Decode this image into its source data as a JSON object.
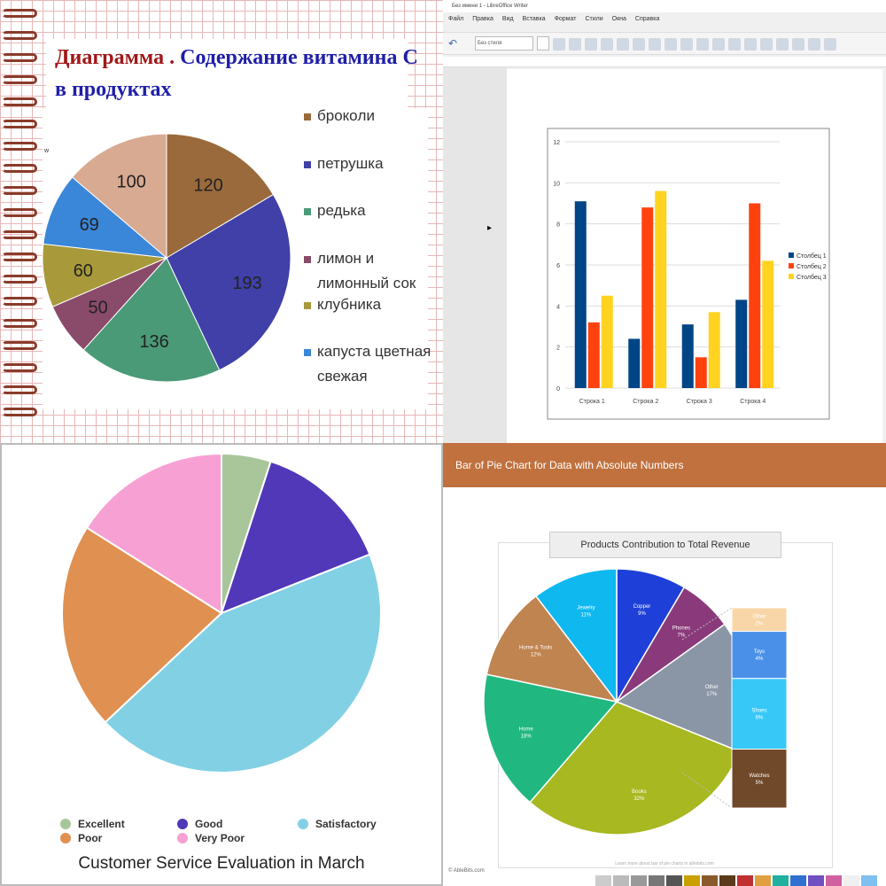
{
  "panel1": {
    "title_part1": "Диаграмма . ",
    "title_part2": "Содержание витамина С",
    "title_line2": "в продуктах",
    "chart_data": {
      "type": "pie",
      "title": "Диаграмма . Содержание витамина С в продуктах",
      "categories": [
        "брокoли",
        "петрушка",
        "редька",
        "лимон и лимонный сок",
        "клубника",
        "капуста цветная свежая",
        ""
      ],
      "values": [
        120,
        193,
        136,
        50,
        60,
        69,
        100
      ],
      "labels": [
        "120",
        "193",
        "136",
        "50",
        "60",
        "69",
        "100"
      ],
      "colors": [
        "#9a6a3c",
        "#4040a8",
        "#4a9a78",
        "#8a4a6a",
        "#a89a3a",
        "#3a86d8",
        "#d8aa92"
      ]
    },
    "legend": [
      "брокoли",
      "петрушка",
      "редька",
      "лимон и",
      "лимонный сок",
      "клубника",
      "капуста цветная",
      "свежая"
    ],
    "legend_colors": [
      "#9a6a3c",
      "#4040a8",
      "#4a9a78",
      "#8a4a6a",
      "#a89a3a",
      "#3a86d8"
    ]
  },
  "panel2": {
    "window_title": "Без имени 1 - LibreOffice Writer",
    "menu": [
      "Файл",
      "Правка",
      "Вид",
      "Вставка",
      "Формат",
      "Стили",
      "Окна",
      "Справка"
    ],
    "font_box": "Без стиля",
    "chart_data": {
      "type": "bar",
      "categories": [
        "Строка 1",
        "Строка 2",
        "Строка 3",
        "Строка 4"
      ],
      "series": [
        {
          "name": "Столбец 1",
          "values": [
            9.1,
            2.4,
            3.1,
            4.3
          ],
          "color": "#004586"
        },
        {
          "name": "Столбец 2",
          "values": [
            3.2,
            8.8,
            1.5,
            9.0
          ],
          "color": "#ff420e"
        },
        {
          "name": "Столбец 3",
          "values": [
            4.5,
            9.6,
            3.7,
            6.2
          ],
          "color": "#ffd320"
        }
      ],
      "ylim": [
        0,
        12
      ],
      "yticks": [
        "0",
        "2",
        "4",
        "6",
        "8",
        "10",
        "12"
      ],
      "grid": true,
      "legend": "right"
    }
  },
  "panel3": {
    "chart_data": {
      "type": "pie",
      "title": "Customer Service Evaluation in March",
      "categories": [
        "Excellent",
        "Good",
        "Satisfactory",
        "Poor",
        "Very Poor"
      ],
      "values": [
        5,
        14,
        44,
        21,
        16
      ],
      "colors": [
        "#a9c69a",
        "#5038b8",
        "#82d0e4",
        "#e09050",
        "#f7a0d4"
      ]
    },
    "legend": [
      "Excellent",
      "Good",
      "Satisfactory",
      "Poor",
      "Very Poor"
    ],
    "title": "Customer Service Evaluation in March"
  },
  "panel4": {
    "banner": "Bar of Pie Chart for Data with Absolute Numbers",
    "chart_data": {
      "type": "pie",
      "title": "Products Contribution to Total Revenue",
      "categories": [
        "Copper",
        "Phones",
        "Other",
        "Books",
        "Home",
        "Home & Tools",
        "Jewelry"
      ],
      "values": [
        9,
        7,
        17,
        32,
        18,
        12,
        11
      ],
      "labels": [
        "9%",
        "7%",
        "17%",
        "32%",
        "18%",
        "12%",
        "11%"
      ],
      "colors": [
        "#1e40d8",
        "#8a3a7a",
        "#8a96a6",
        "#a8b820",
        "#20b880",
        "#c08450",
        "#10b8f0"
      ],
      "bar_categories": [
        "Other",
        "Toys",
        "Shoes",
        "Watches"
      ],
      "bar_values": [
        2,
        4,
        6,
        5
      ],
      "bar_labels": [
        "2%",
        "4%",
        "6%",
        "5%"
      ],
      "bar_colors": [
        "#f8d6a8",
        "#4a90e8",
        "#38c8f8",
        "#70482a"
      ]
    },
    "note": "Learn more about bar of pie charts in ablebits.com",
    "footer": "© AbleBits.com"
  }
}
